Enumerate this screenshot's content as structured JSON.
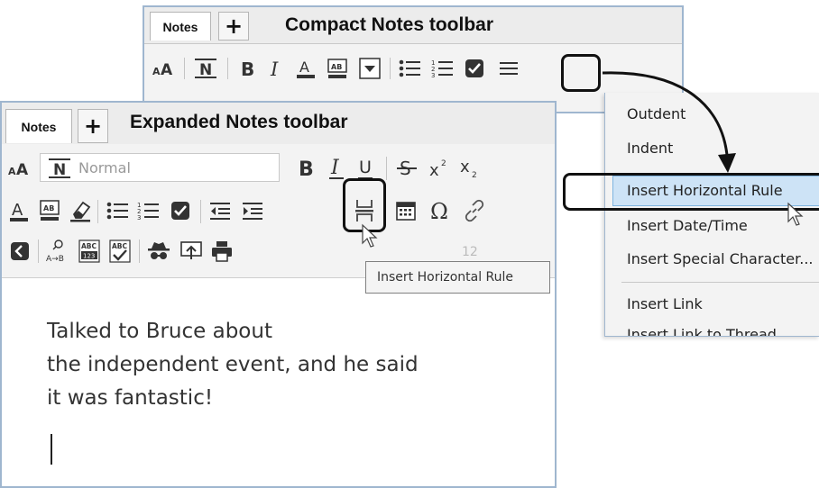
{
  "compact": {
    "tab_label": "Notes",
    "add_tab": "+",
    "caption": "Compact Notes toolbar",
    "toolbar": [
      "font-size-icon",
      "normal-style-icon",
      "bold-icon",
      "italic-icon",
      "text-color-icon",
      "highlight-icon",
      "dropdown-icon",
      "bullet-list-icon",
      "numbered-list-icon",
      "checkbox-icon",
      "more-menu-icon"
    ]
  },
  "expanded": {
    "tab_label": "Notes",
    "add_tab": "+",
    "caption": "Expanded Notes toolbar",
    "style_value": "Normal",
    "font_size_value": "12",
    "tooltip": "Insert Horizontal Rule",
    "content": {
      "line1": "Talked to Bruce about",
      "line2": "the independent event, and he said",
      "line3": "it was fantastic!"
    }
  },
  "menu": {
    "items": [
      "Outdent",
      "Indent",
      "Insert Horizontal Rule",
      "Insert Date/Time",
      "Insert Special Character...",
      "Insert Link",
      "Insert Link to Thread..."
    ],
    "highlighted": "Insert Horizontal Rule"
  },
  "colors": {
    "panel_border": "#9fb6cf",
    "menu_highlight": "#cde3f6",
    "checkbox": "#333333",
    "link_icon": "#555555"
  }
}
